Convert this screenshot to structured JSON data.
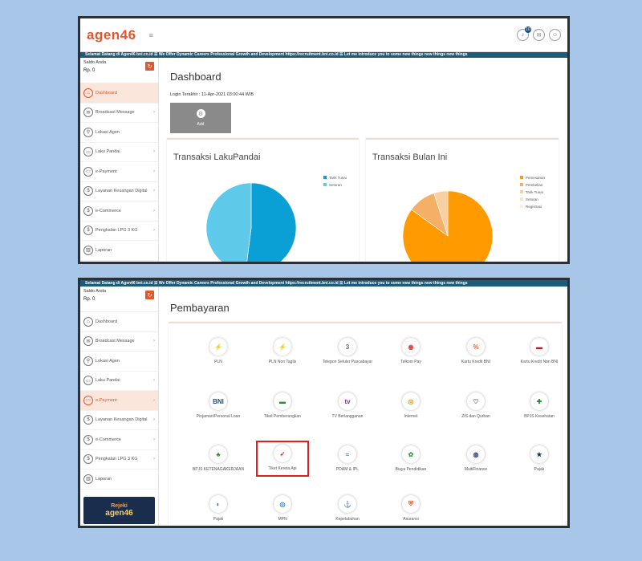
{
  "header": {
    "logo": "agen46",
    "menu_icon": "≡",
    "notif_count": "10"
  },
  "ticker": "Selamat Datang di Agen46 bni.co.id ☰ We Offer Dynamic Careers Professional Growth and Development https://recruitment.bni.co.id ☰ Let me introduce you to some new things new things new things",
  "sidebar": {
    "saldo_label": "Saldo Anda",
    "saldo_value": "Rp. 0",
    "refresh_icon": "↻",
    "items": [
      {
        "label": "Dashboard",
        "icon": "⌂"
      },
      {
        "label": "Broadcast Message",
        "icon": "✉"
      },
      {
        "label": "Lokasi Agen",
        "icon": "⚲"
      },
      {
        "label": "Laku Pandai",
        "icon": "▭"
      },
      {
        "label": "e-Payment",
        "icon": "▭"
      },
      {
        "label": "Layanan Keuangan Digital",
        "icon": "$"
      },
      {
        "label": "e-Commerce",
        "icon": "$"
      },
      {
        "label": "Pengkalan LPG 3 KG",
        "icon": "$"
      },
      {
        "label": "Laporan",
        "icon": "▥"
      }
    ],
    "promo_line1": "Rejeki",
    "promo_line2": "agen46"
  },
  "dashboard": {
    "title": "Dashboard",
    "login_info": "Login Terakhir : 11-Apr-2021 03:00:44 WIB",
    "app_tile_label": "Add",
    "app_tile_icon": "⚙",
    "card1_title": "Transaksi LakuPandai",
    "card2_title": "Transaksi Bulan Ini"
  },
  "pembayaran": {
    "title": "Pembayaran",
    "items": [
      {
        "label": "PLN",
        "glyph": "⚡",
        "color": "#e8c400"
      },
      {
        "label": "PLN Non Taglis",
        "glyph": "⚡",
        "color": "#e8c400"
      },
      {
        "label": "Telepon Seluler Pascabayar",
        "glyph": "3",
        "color": "#666666"
      },
      {
        "label": "Telkom Pay",
        "glyph": "◉",
        "color": "#e64040"
      },
      {
        "label": "Kartu Kredit BNI",
        "glyph": "%",
        "color": "#e4572e"
      },
      {
        "label": "Kartu Kredit Non BNI",
        "glyph": "▬",
        "color": "#c0202a"
      },
      {
        "label": "Pinjaman/Personal Loan",
        "glyph": "BNI",
        "color": "#1a4f8a"
      },
      {
        "label": "Tiket Pemberangkan",
        "glyph": "▬",
        "color": "#2e8b3a"
      },
      {
        "label": "TV Berlangganan",
        "glyph": "tv",
        "color": "#7a2fa0"
      },
      {
        "label": "Internet",
        "glyph": "◎",
        "color": "#e29a1a"
      },
      {
        "label": "ZIS dan Qurban",
        "glyph": "♡",
        "color": "#555555"
      },
      {
        "label": "BPJS Kesehatan",
        "glyph": "✚",
        "color": "#2e8b3a"
      },
      {
        "label": "BPJS KETENAGAKERJAAN",
        "glyph": "♣",
        "color": "#2e8b3a"
      },
      {
        "label": "Tiket Kereta Api",
        "glyph": "➶",
        "color": "#e64040",
        "selected": true
      },
      {
        "label": "PDAM & IPL",
        "glyph": "≈",
        "color": "#2a8ac4"
      },
      {
        "label": "Biaya Pendidikan",
        "glyph": "✿",
        "color": "#3a9a4a"
      },
      {
        "label": "MultiFinance",
        "glyph": "◍",
        "color": "#3a3a8a"
      },
      {
        "label": "Pajak",
        "glyph": "★",
        "color": "#1b2d4d"
      },
      {
        "label": "Pajak",
        "glyph": "◐",
        "color": "#2a6aa0"
      },
      {
        "label": "MPN",
        "glyph": "◎",
        "color": "#2a8ac4"
      },
      {
        "label": "Kepelabuhan",
        "glyph": "⚓",
        "color": "#2a8ac4"
      },
      {
        "label": "Asuransi",
        "glyph": "⛨",
        "color": "#e4572e"
      }
    ]
  },
  "chart_data": [
    {
      "type": "pie",
      "title": "Transaksi LakuPandai",
      "categories": [
        "Tarik Tunai",
        "Setoran"
      ],
      "values": [
        52,
        48
      ],
      "colors": [
        "#0aa0d6",
        "#5ec9e8"
      ],
      "legend": "right"
    },
    {
      "type": "pie",
      "title": "Transaksi Bulan Ini",
      "categories": [
        "Pemesanan",
        "Pembelian",
        "Tarik Tunai",
        "Setoran",
        "Registrasi"
      ],
      "values": [
        85,
        10,
        5,
        0,
        0
      ],
      "colors": [
        "#ff9a00",
        "#f5b068",
        "#f7d0a4",
        "#fbe2c6",
        "#fdeede"
      ],
      "legend": "right"
    }
  ]
}
